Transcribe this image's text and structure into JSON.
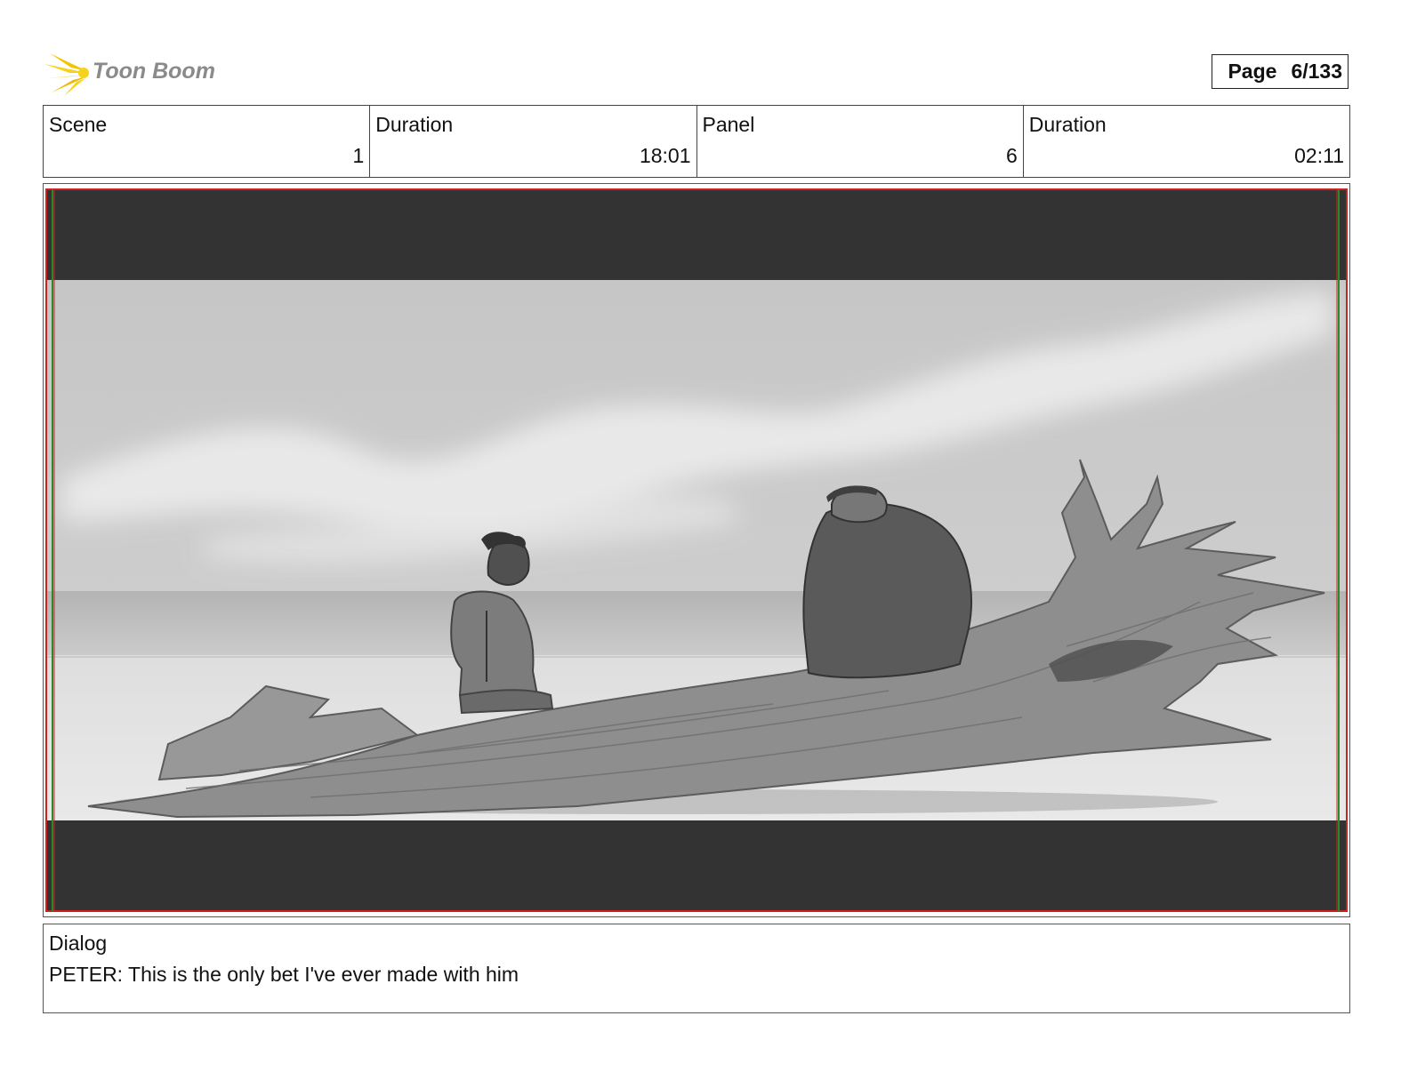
{
  "header": {
    "logo_text": "Toon Boom",
    "page_label": "Page",
    "page_number": "6/133"
  },
  "info": {
    "scene": {
      "label": "Scene",
      "value": "1"
    },
    "scene_duration": {
      "label": "Duration",
      "value": "18:01"
    },
    "panel": {
      "label": "Panel",
      "value": "6"
    },
    "panel_duration": {
      "label": "Duration",
      "value": "02:11"
    }
  },
  "panel_image": {
    "description_icon": "storyboard-drawing",
    "letterbox_color": "#333333",
    "safe_frame_colors": [
      "#cc2222",
      "#2a8a2a"
    ]
  },
  "dialog": {
    "label": "Dialog",
    "text": "PETER: This is the only bet I've ever made with him"
  }
}
